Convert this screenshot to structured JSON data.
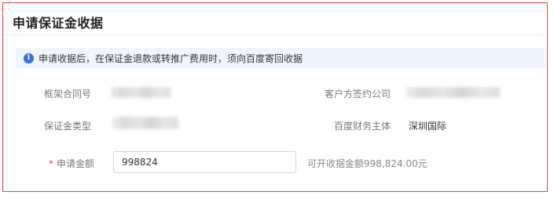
{
  "dialog": {
    "title": "申请保证金收据",
    "notice": "申请收据后，在保证金退款或转推广费用时，须向百度寄回收据",
    "fields": {
      "framework_contract_no_label": "框架合同号",
      "customer_company_label": "客户方签约公司",
      "deposit_type_label": "保证金类型",
      "baidu_entity_label": "百度财务主体",
      "baidu_entity_value": "深圳国际",
      "amount_label": "申请金额",
      "amount_required_mark": "*",
      "amount_value": "998824",
      "amount_hint": "可开收据金额998,824.00元"
    }
  },
  "icons": {
    "notice_icon": "info-icon",
    "notice_icon_glyph": "i"
  },
  "colors": {
    "border_accent": "#e8453c",
    "info_blue": "#2f6fe0",
    "notice_bg": "#f0f5fd"
  }
}
